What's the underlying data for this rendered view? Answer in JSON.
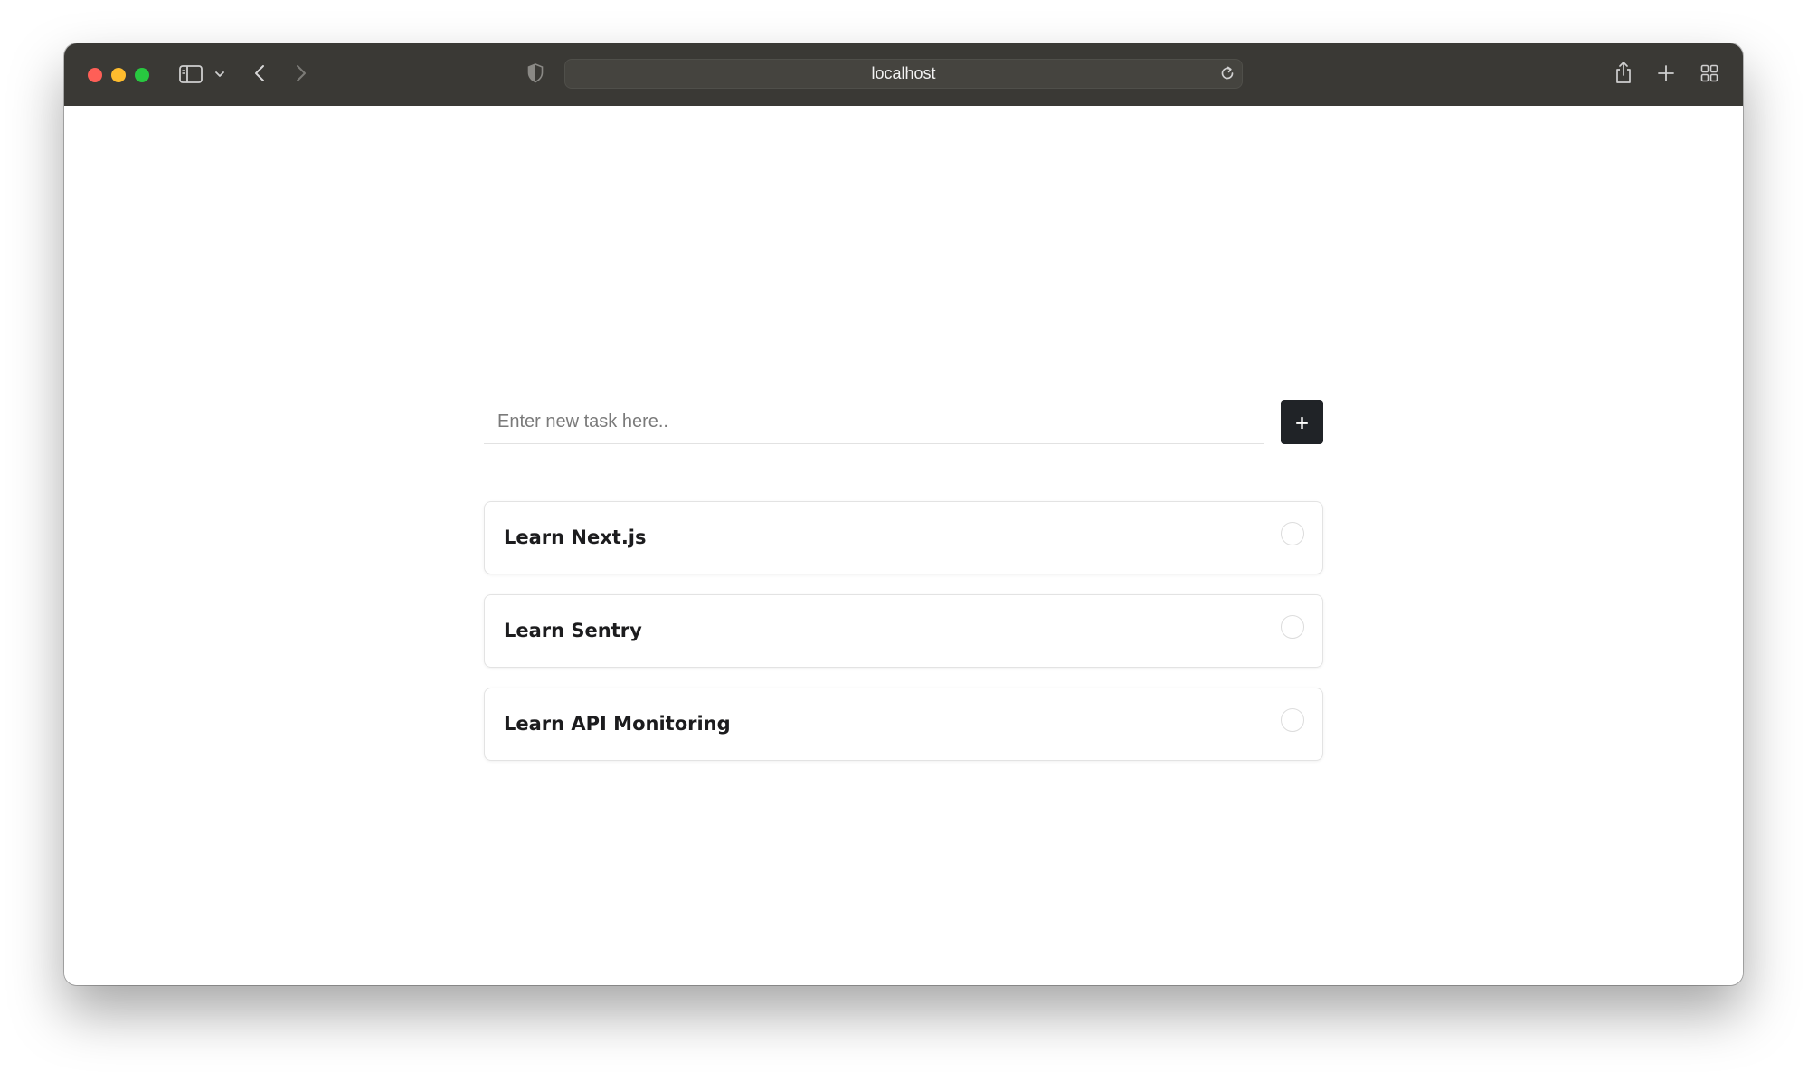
{
  "browser": {
    "address": "localhost",
    "colors": {
      "titlebar": "#3a3935",
      "close": "#fe5f57",
      "minimize": "#febc2e",
      "zoom": "#28c840"
    },
    "icons": [
      "sidebar-icon",
      "chevron-down-icon",
      "back-icon",
      "forward-icon",
      "shield-icon",
      "reload-icon",
      "share-icon",
      "new-tab-icon",
      "tab-overview-icon"
    ]
  },
  "task_form": {
    "placeholder": "Enter new task here..",
    "value": "",
    "add_label": "+"
  },
  "tasks": [
    {
      "label": "Learn Next.js",
      "done": false
    },
    {
      "label": "Learn Sentry",
      "done": false
    },
    {
      "label": "Learn API Monitoring",
      "done": false
    }
  ]
}
